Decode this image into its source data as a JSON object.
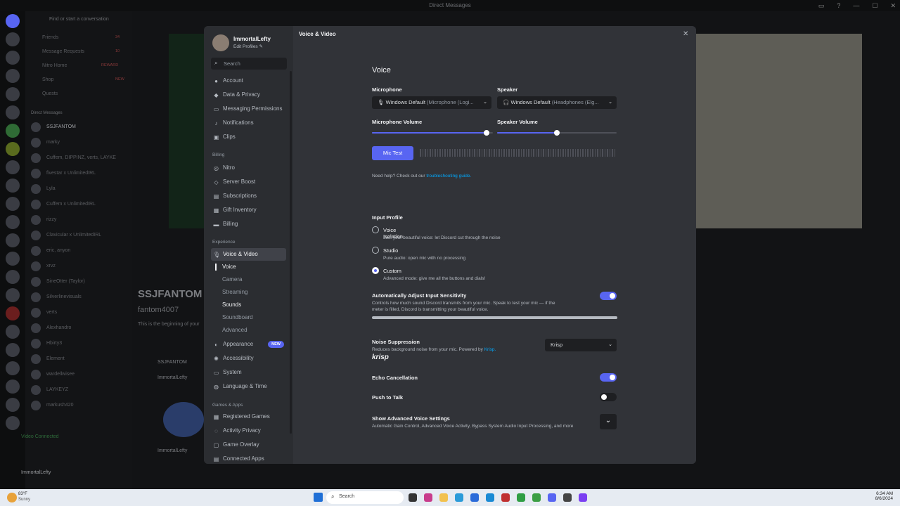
{
  "window": {
    "title": "Direct Messages"
  },
  "background": {
    "search_placeholder": "Find or start a conversation",
    "dm_nav": [
      {
        "label": "Friends",
        "badge": "34"
      },
      {
        "label": "Message Requests",
        "badge": "10"
      },
      {
        "label": "Nitro Home",
        "badge": "REWARD"
      },
      {
        "label": "Shop",
        "badge": "NEW"
      },
      {
        "label": "Quests",
        "badge": ""
      }
    ],
    "dm_header": "Direct Messages",
    "dm_list": [
      "SSJFANTOM",
      "marky",
      "Cuffem, DIPPINZ, verts, LAYKE",
      "fivestar x UnlimitedIRL",
      "Lyla",
      "Cuffem x UnlimitedIRL",
      "rizzy",
      "Clavicular x UnlimitedIRL",
      "eric, anyon",
      "xrvz",
      "SineOtter (Taylor)",
      "Silverlinevisuals",
      "verts",
      "Alexhandro",
      "Hbirty3",
      "Element",
      "wardellwisee",
      "LAYKEYZ",
      "markush420"
    ],
    "profile_big": "SSJFANTOM",
    "profile_handle": "fantom4007",
    "profile_begin": "This is the beginning of your",
    "chat_user": "ImmortalLefty",
    "msg_user": "SSJFANTOM",
    "voice_status": "Video Connected",
    "user_name": "ImmortalLefty"
  },
  "sidebar": {
    "user_name": "ImmortalLefty",
    "edit_profiles": "Edit Profiles",
    "search_placeholder": "Search",
    "user_settings": [
      {
        "label": "Account",
        "icon": "user-icon"
      },
      {
        "label": "Data & Privacy",
        "icon": "shield-icon"
      },
      {
        "label": "Messaging Permissions",
        "icon": "chat-icon"
      },
      {
        "label": "Notifications",
        "icon": "bell-icon"
      },
      {
        "label": "Clips",
        "icon": "clips-icon"
      }
    ],
    "billing_header": "Billing",
    "billing": [
      {
        "label": "Nitro",
        "icon": "nitro-icon"
      },
      {
        "label": "Server Boost",
        "icon": "boost-icon"
      },
      {
        "label": "Subscriptions",
        "icon": "subscriptions-icon"
      },
      {
        "label": "Gift Inventory",
        "icon": "gift-icon"
      },
      {
        "label": "Billing",
        "icon": "card-icon"
      }
    ],
    "experience_header": "Experience",
    "voice_video": "Voice & Video",
    "voice_sub": [
      "Voice",
      "Camera",
      "Streaming",
      "Sounds",
      "Soundboard",
      "Advanced"
    ],
    "experience": [
      {
        "label": "Appearance",
        "icon": "palette-icon",
        "badge": "NEW"
      },
      {
        "label": "Accessibility",
        "icon": "accessibility-icon"
      },
      {
        "label": "System",
        "icon": "monitor-icon"
      },
      {
        "label": "Language & Time",
        "icon": "globe-icon"
      }
    ],
    "games_header": "Games & Apps",
    "games": [
      {
        "label": "Registered Games",
        "icon": "gamepad-icon"
      },
      {
        "label": "Activity Privacy",
        "icon": "privacy-icon"
      },
      {
        "label": "Game Overlay",
        "icon": "overlay-icon"
      },
      {
        "label": "Connected Apps",
        "icon": "apps-icon"
      }
    ]
  },
  "main": {
    "breadcrumb": "Voice & Video",
    "section_title": "Voice",
    "microphone_label": "Microphone",
    "microphone_value": "Windows Default",
    "microphone_detail": "(Microphone (Logi...",
    "speaker_label": "Speaker",
    "speaker_value": "Windows Default",
    "speaker_detail": "(Headphones (Elg...",
    "mic_volume_label": "Microphone Volume",
    "mic_volume": 0.95,
    "speaker_volume_label": "Speaker Volume",
    "speaker_volume": 0.5,
    "mic_test_label": "Mic Test",
    "help_text": "Need help? Check out our",
    "help_link": "troubleshooting guide.",
    "input_profile_label": "Input Profile",
    "profiles": [
      {
        "label": "Voice Isolation",
        "desc": "Just your beautiful voice: let Discord cut through the noise",
        "selected": false
      },
      {
        "label": "Studio",
        "desc": "Pure audio: open mic with no processing",
        "selected": false
      },
      {
        "label": "Custom",
        "desc": "Advanced mode: give me all the buttons and dials!",
        "selected": true
      }
    ],
    "auto_sens_label": "Automatically Adjust Input Sensitivity",
    "auto_sens_desc1": "Controls how much sound Discord transmits from your mic. Speak to test your mic — if the",
    "auto_sens_desc2": "meter is filled, Discord is transmitting your beautiful voice.",
    "auto_sens_on": true,
    "noise_label": "Noise Suppression",
    "noise_desc": "Reduces background noise from your mic. Powered by",
    "noise_link": "Krisp.",
    "noise_value": "Krisp",
    "krisp_logo": "krisp",
    "echo_label": "Echo Cancellation",
    "echo_on": true,
    "ptt_label": "Push to Talk",
    "ptt_on": false,
    "advanced_label": "Show Advanced Voice Settings",
    "advanced_desc": "Automatic Gain Control, Advanced Voice Activity, Bypass System Audio Input Processing, and more"
  },
  "taskbar": {
    "weather_temp": "83°F",
    "weather_cond": "Sunny",
    "search_placeholder": "Search",
    "time": "6:34 AM",
    "date": "8/6/2024"
  },
  "colors": {
    "accent": "#5865f2",
    "sidebar": "#2b2d31",
    "panel": "#313338"
  }
}
